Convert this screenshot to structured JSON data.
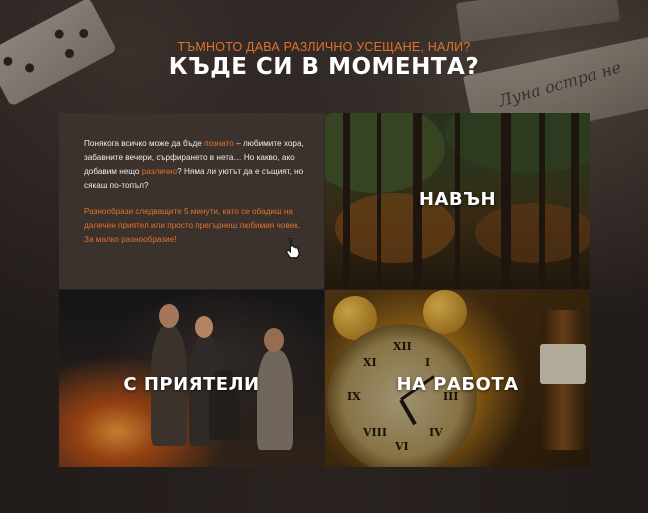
{
  "header": {
    "subtitle": "ТЪМНОТО ДАВА РАЗЛИЧНО УСЕЩАНЕ, НАЛИ?",
    "title": "КЪДЕ СИ В МОМЕНТА?"
  },
  "background": {
    "note_text": "Луна остра не"
  },
  "intro": {
    "part1": "Понякога всичко може да бъде ",
    "hl1": "познато",
    "part2": " – любимите хора, забавните вечери, сърфирането в нета… Но какво, ако добавим нещо ",
    "hl2": "различно",
    "part3": "? Няма ли уютът да е същият, но сякаш по-топъл?",
    "cta": "Разнообрази следващите 5 минути, като се обадиш на далечен приятел или просто прегърнеш любимия човек. За малко разнообразие!"
  },
  "tiles": {
    "outside": "НАВЪН",
    "friends": "С ПРИЯТЕЛИ",
    "work": "НА РАБОТА"
  },
  "colors": {
    "accent": "#e0722c",
    "panel": "#3b322e",
    "background": "#221c1a"
  },
  "icons": {
    "cursor": "hand-pointer-icon"
  }
}
